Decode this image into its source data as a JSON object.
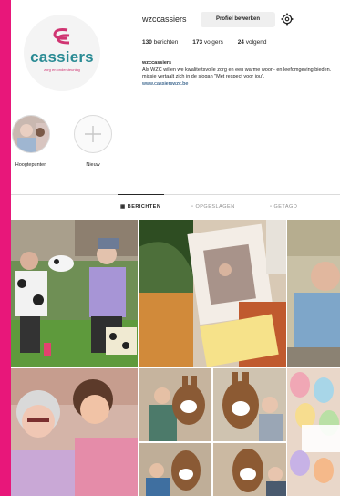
{
  "profile": {
    "logo_text": "cassiers",
    "logo_tagline": "zorg en ondersteuning",
    "username": "wzccassiers",
    "edit_button": "Profiel bewerken",
    "stats": {
      "posts": "130",
      "posts_label": "berichten",
      "followers": "173",
      "followers_label": "volgers",
      "following": "24",
      "following_label": "volgend"
    },
    "bio": {
      "name": "wzccassiers",
      "line1": "Als WZC willen we kwaliteitsvolle zorg en een warme woon- en leefomgeving bieden.",
      "line2": "missie vertaalt zich in de slogan \"Met respect voor jou\".",
      "link": "www.cassierswzc.be"
    }
  },
  "highlights": [
    {
      "label": "Hoogtepunten"
    },
    {
      "label": "Nieuw"
    }
  ],
  "tabs": [
    {
      "label": "BERICHTEN",
      "active": true
    },
    {
      "label": "OPGESLAGEN",
      "active": false
    },
    {
      "label": "GETAGD",
      "active": false
    }
  ],
  "colors": {
    "brand_teal": "#2a8b94",
    "brand_pink": "#d03572",
    "frame_pink": "#e8177a"
  }
}
